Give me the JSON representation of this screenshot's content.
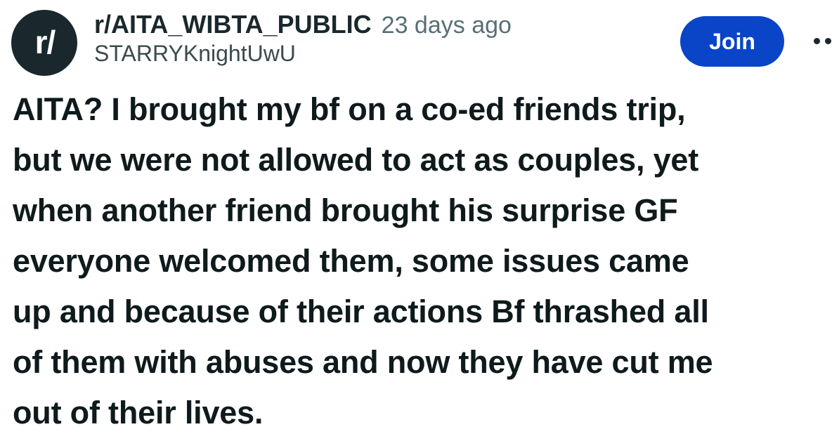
{
  "header": {
    "avatar_text": "r/",
    "subreddit": "r/AITA_WIBTA_PUBLIC",
    "timestamp": "23 days ago",
    "username": "STARRYKnightUwU",
    "join_label": "Join",
    "overflow_icon": "more-horizontal-icon"
  },
  "post": {
    "title_lines": [
      "AITA? I brought my bf on a co-ed friends trip,",
      "but we were not allowed to act as couples, yet",
      "when another friend brought his surprise GF",
      "everyone welcomed them, some issues came",
      "up and because of their actions Bf thrashed all",
      "of them with abuses and now they have cut me",
      "out of their lives."
    ]
  },
  "colors": {
    "avatar_bg": "#1a282d",
    "join_button_bg": "#0a45c8",
    "text_primary": "#0f1a1c",
    "text_secondary": "#576f76"
  }
}
